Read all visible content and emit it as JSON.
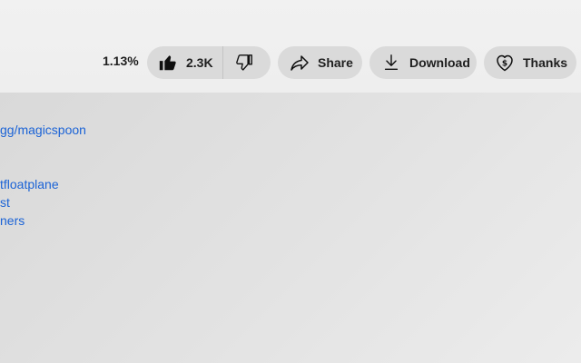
{
  "action_bar": {
    "percent": "1.13%",
    "like_count": "2.3K",
    "share_label": "Share",
    "download_label": "Download",
    "thanks_label": "Thanks"
  },
  "description_links": [
    "gg/magicspoon",
    "tfloatplane",
    "st",
    "ners"
  ],
  "icons": [
    "thumbs-up-icon",
    "thumbs-down-icon",
    "share-arrow-icon",
    "download-icon",
    "heart-dollar-icon"
  ],
  "colors": {
    "link": "#1b63d6",
    "pill_background": "#dadada",
    "text": "#1f1f1f"
  }
}
